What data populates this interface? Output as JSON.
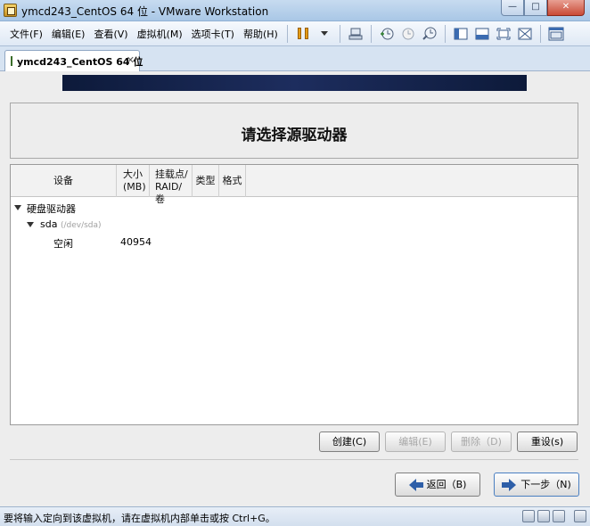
{
  "window": {
    "title": "ymcd243_CentOS 64 位 - VMware Workstation",
    "minimize_label": "—",
    "maximize_label": "□",
    "close_label": "✕"
  },
  "menu": {
    "items": [
      "文件(F)",
      "编辑(E)",
      "查看(V)",
      "虚拟机(M)",
      "选项卡(T)",
      "帮助(H)"
    ]
  },
  "tab": {
    "label": "ymcd243_CentOS 64 位",
    "close_label": "✕"
  },
  "installer": {
    "heading": "请选择源驱动器",
    "columns": {
      "device": "设备",
      "size_line1": "大小",
      "size_line2": "(MB)",
      "mount_line1": "挂载点/",
      "mount_line2": "RAID/卷",
      "type": "类型",
      "format": "格式"
    },
    "rows": {
      "hard_drives": "硬盘驱动器",
      "sda_name": "sda",
      "sda_path": "(/dev/sda)",
      "free_label": "空闲",
      "free_size": "40954"
    },
    "buttons": {
      "create": "创建(C)",
      "edit": "编辑(E)",
      "delete": "删除（D)",
      "reset": "重设(s)",
      "back": "返回（B)",
      "next": "下一步（N)"
    }
  },
  "statusbar": {
    "text": "要将输入定向到该虚拟机，请在虚拟机内部单击或按 Ctrl+G。"
  }
}
